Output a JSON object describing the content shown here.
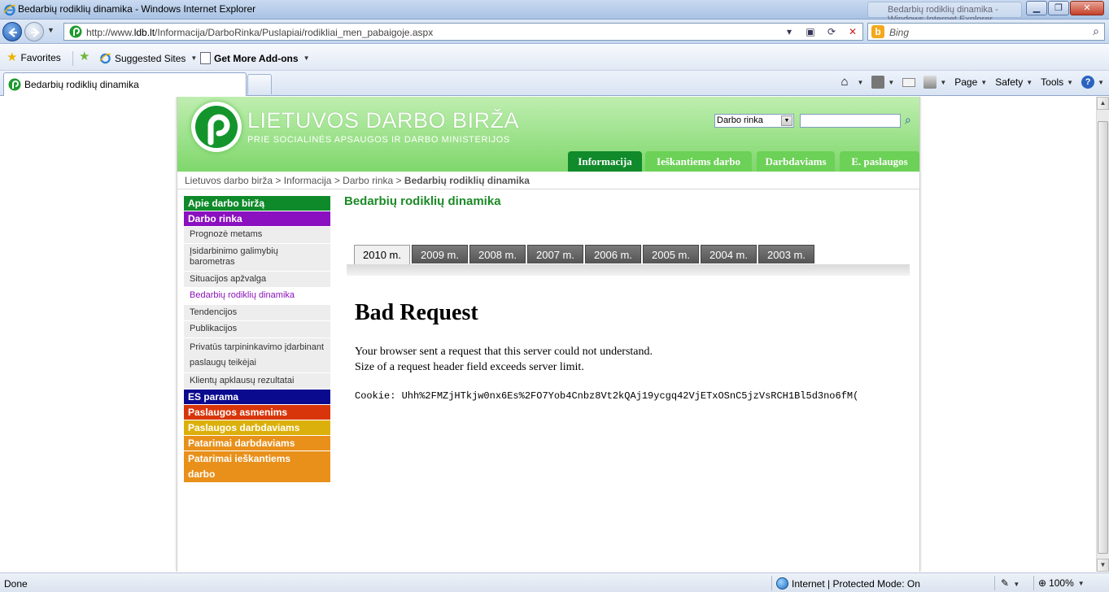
{
  "browser": {
    "window_title": "Bedarbių rodiklių dinamika - Windows Internet Explorer",
    "url_prefix": "http://www.",
    "url_domain": "ldb.lt",
    "url_path": "/Informacija/DarboRinka/Puslapiai/rodikliai_men_pabaigoje.aspx",
    "search_placeholder": "Bing",
    "favorites_label": "Favorites",
    "suggested_sites_label": "Suggested Sites",
    "addons_label": "Get More Add-ons",
    "tab_title": "Bedarbių rodiklių dinamika",
    "commands": {
      "page": "Page",
      "safety": "Safety",
      "tools": "Tools"
    },
    "status_text": "Done",
    "zone_text": "Internet | Protected Mode: On",
    "zoom": "100%",
    "colors": {
      "chrome": "#c9daf0",
      "accent": "#1f5bb0"
    }
  },
  "site": {
    "brand": "LIETUVOS DARBO BIRŽA",
    "brand_sub": "PRIE SOCIALINĖS APSAUGOS IR DARBO MINISTERIJOS",
    "search_select_value": "Darbo rinka",
    "main_tabs": [
      "Informacija",
      "Ieškantiems darbo",
      "Darbdaviams",
      "E. paslaugos"
    ],
    "breadcrumb": {
      "items": [
        "Lietuvos darbo birža",
        "Darbo rinka"
      ],
      "middle": "Informacija",
      "separator": ">",
      "current": "Bedarbių rodiklių dinamika"
    },
    "nav": {
      "apie": "Apie darbo biržą",
      "darbo_rinka": "Darbo rinka",
      "subitems": [
        "Prognozė metams",
        "Įsidarbinimo galimybių barometras",
        "Situacijos apžvalga",
        "Bedarbių rodiklių dinamika",
        "Tendencijos",
        "Publikacijos",
        "Privatūs tarpininkavimo įdarbinant paslaugų teikėjai",
        "Klientų apklausų rezultatai"
      ],
      "es_parama": "ES parama",
      "paslaugos_asmenims": "Paslaugos asmenims",
      "paslaugos_darbdaviams": "Paslaugos darbdaviams",
      "patarimai_darbdaviams": "Patarimai darbdaviams",
      "patarimai_ieskantiems": "Patarimai ieškantiems darbo"
    },
    "nav_colors": {
      "apie": "#0f8a2a",
      "darbo_rinka": "#8a10c0",
      "es_parama": "#0a0a8f",
      "paslaugos_asmenims": "#d8360a",
      "paslaugos_darbdaviams": "#dcb00c",
      "patarimai_darbdaviams": "#e8901a",
      "patarimai_ieskantiems": "#e8901a"
    },
    "page_title": "Bedarbių rodiklių dinamika",
    "year_tabs": [
      "2010 m.",
      "2009 m.",
      "2008 m.",
      "2007 m.",
      "2006 m.",
      "2005 m.",
      "2004 m.",
      "2003 m."
    ],
    "error": {
      "title": "Bad Request",
      "line1": "Your browser sent a request that this server could not understand.",
      "line2": "Size of a request header field exceeds server limit.",
      "cookie": "Cookie: Uhh%2FMZjHTkjw0nx6Es%2FO7Yob4Cnbz8Vt2kQAj19ycgq42VjETxOSnC5jzVsRCH1Bl5d3no6fM("
    }
  }
}
